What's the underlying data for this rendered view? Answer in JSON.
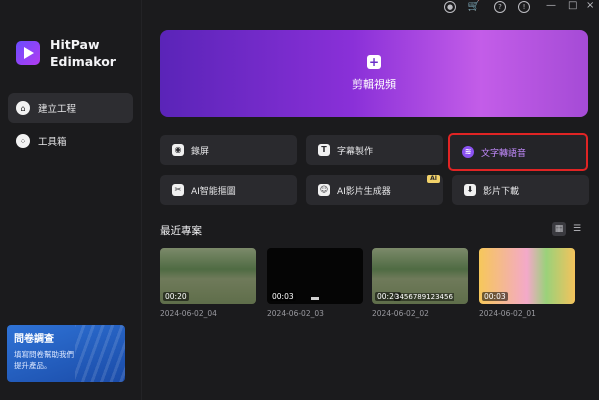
{
  "app": {
    "brand_line1": "HitPaw",
    "brand_line2": "Edimakor"
  },
  "sidebar": {
    "items": [
      {
        "label": "建立工程",
        "icon": "home-icon",
        "active": true
      },
      {
        "label": "工具箱",
        "icon": "toolbox-icon",
        "active": false
      }
    ],
    "survey": {
      "title": "問卷調查",
      "desc_line1": "填寫問卷幫助我們",
      "desc_line2": "提升產品。"
    }
  },
  "topbar": {
    "icons": [
      "user-icon",
      "cart-icon",
      "help-icon",
      "info-icon"
    ],
    "window": {
      "min": "—",
      "max": "□",
      "close": "×"
    }
  },
  "hero": {
    "label": "剪輯視頻",
    "colors": [
      "#5a24b8",
      "#c35de8"
    ]
  },
  "tools": [
    {
      "label": "錄屏",
      "icon": "record-icon"
    },
    {
      "label": "字幕製作",
      "icon": "subtitle-icon"
    },
    {
      "label": "文字轉語音",
      "icon": "text-to-speech-icon",
      "highlighted": true
    },
    {
      "label": "AI智能摳圖",
      "icon": "ai-cutout-icon"
    },
    {
      "label": "AI影片生成器",
      "icon": "ai-video-icon",
      "badge": "AI"
    },
    {
      "label": "影片下載",
      "icon": "download-icon"
    }
  ],
  "recent": {
    "title": "最近專案",
    "projects": [
      {
        "duration": "00:20",
        "date": "2024-06-02_04"
      },
      {
        "duration": "00:03",
        "date": "2024-06-02_03"
      },
      {
        "duration": "00:20",
        "date": "2024-06-02_02",
        "overlay": "3456789123456"
      },
      {
        "duration": "00:03",
        "date": "2024-06-02_01"
      }
    ]
  },
  "colors": {
    "accent": "#8b52f2",
    "highlight_border": "#e02424",
    "background": "#1b1b1d"
  }
}
